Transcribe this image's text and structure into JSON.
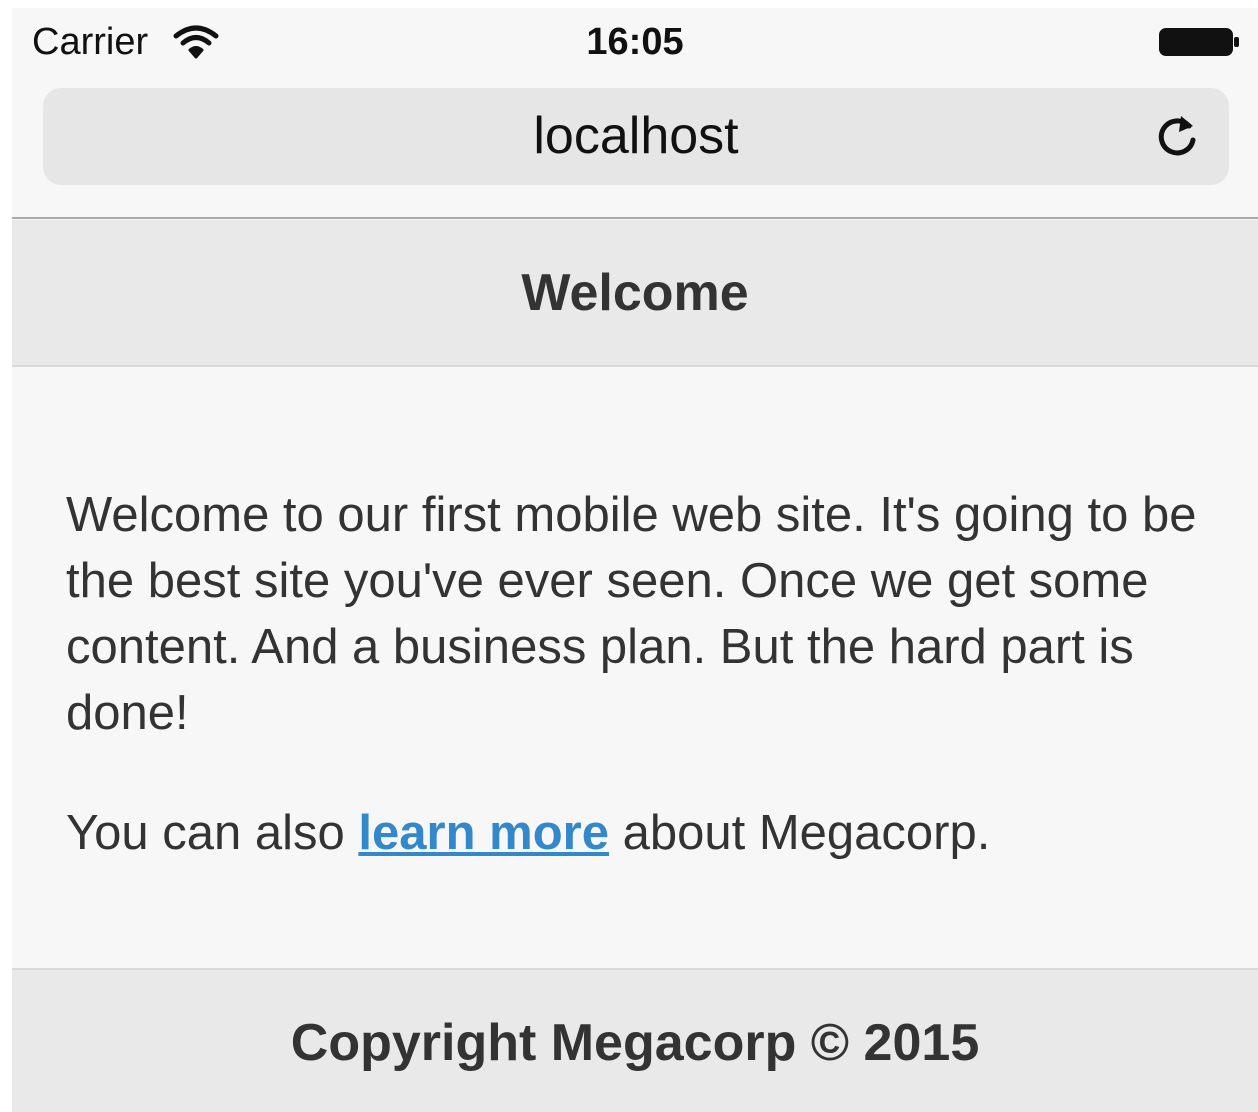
{
  "status_bar": {
    "carrier": "Carrier",
    "time": "16:05"
  },
  "browser": {
    "url": "localhost"
  },
  "header": {
    "title": "Welcome"
  },
  "content": {
    "paragraph1": "Welcome to our first mobile web site. It's going to be the best site you've ever seen. Once we get some content. And a business plan. But the hard part is done!",
    "paragraph2_before": "You can also ",
    "link_label": "learn more",
    "paragraph2_after": " about Megacorp."
  },
  "footer": {
    "text": "Copyright Megacorp © 2015"
  },
  "icons": {
    "wifi": "wifi-icon",
    "battery": "battery-icon",
    "reload": "reload-icon"
  },
  "colors": {
    "link": "#3388cc",
    "bar_background": "#e9e9e9",
    "page_background": "#f7f7f7",
    "text": "#333333"
  }
}
